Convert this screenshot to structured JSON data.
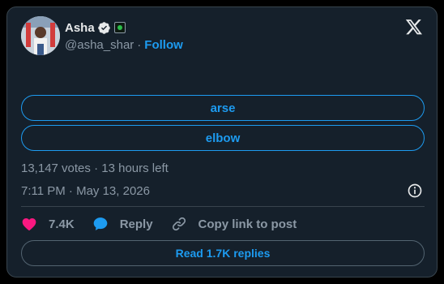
{
  "author": {
    "display_name": "Asha",
    "handle": "@asha_shar",
    "separator": "·",
    "follow_label": "Follow"
  },
  "poll": {
    "options": [
      "arse",
      "elbow"
    ],
    "votes": "13,147 votes",
    "separator": "·",
    "time_left": "13 hours left"
  },
  "timestamp": "7:11 PM · May 13, 2026",
  "actions": {
    "likes": "7.4K",
    "reply_label": "Reply",
    "copy_label": "Copy link to post"
  },
  "read_replies_label": "Read 1.7K replies",
  "colors": {
    "background": "#15202b",
    "accent": "#1d9bf0",
    "like": "#f91880",
    "border": "#38444d",
    "muted": "#8b98a5"
  },
  "icons": [
    "verified-badge-icon",
    "affiliate-badge-icon",
    "x-logo-icon",
    "info-icon",
    "heart-icon",
    "reply-bubble-icon",
    "link-icon"
  ]
}
